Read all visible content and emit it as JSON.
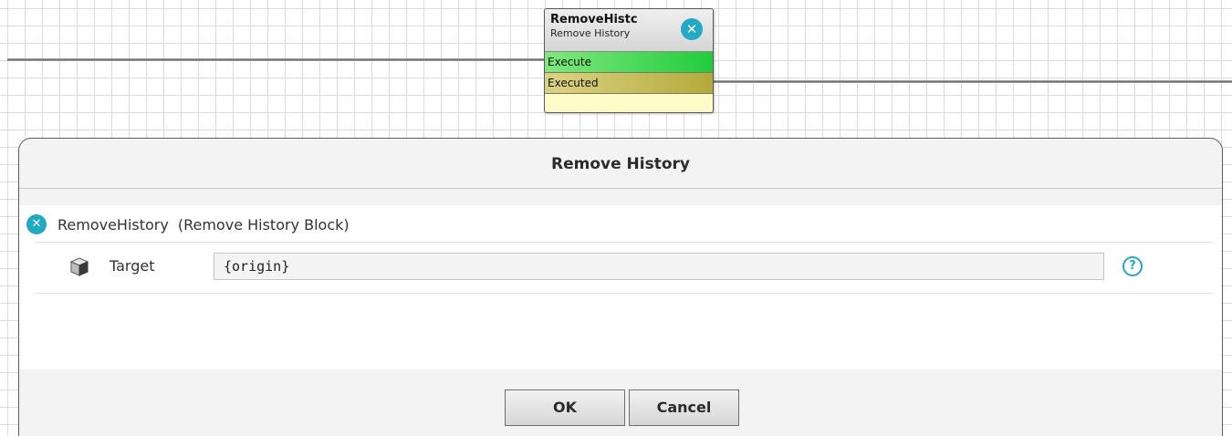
{
  "canvas": {
    "block": {
      "name": "RemoveHistc",
      "type": "Remove History",
      "ports": [
        {
          "label": "Execute"
        },
        {
          "label": "Executed"
        }
      ],
      "status_icon": "x-circle-icon"
    }
  },
  "dialog": {
    "title": "Remove History",
    "block_name": "RemoveHistory",
    "block_desc": "(Remove History Block)",
    "target": {
      "label": "Target",
      "value": "{origin}",
      "icon": "cube-icon",
      "help_icon": "help-icon"
    },
    "buttons": {
      "ok": "OK",
      "cancel": "Cancel"
    }
  },
  "colors": {
    "accent": "#22a9c4",
    "execute_port": "#22cc3c",
    "executed_port": "#b3aa3c",
    "block_body": "#fdfbc7"
  }
}
